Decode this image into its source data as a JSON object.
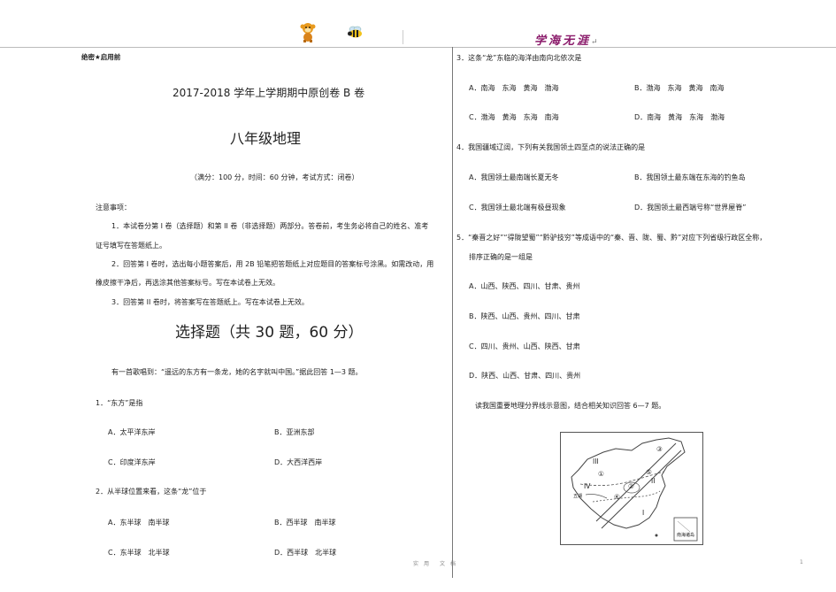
{
  "header": {
    "brand": "学海无涯",
    "brand_mark": "↵"
  },
  "left": {
    "secret_label": "绝密★启用前",
    "exam_title": "2017-2018 学年上学期期中原创卷 B 卷",
    "subject_title": "八年级地理",
    "exam_info": "（满分：100 分，时间：60 分钟，考试方式：闭卷）",
    "notes_heading": "注意事项：",
    "note1_a": "1．本试卷分第 I 卷（选择题）和第 II 卷（非选择题）两部分。答卷前，考生务必将自己的姓名、准考",
    "note1_b": "证号填写在答题纸上。",
    "note2_a": "2．回答第 I 卷时，选出每小题答案后，用 2B 铅笔把答题纸上对应题目的答案标号涂黑。如需改动，用",
    "note2_b": "橡皮擦干净后，再选涂其他答案标号。写在本试卷上无效。",
    "note3": "3．回答第 II 卷时，将答案写在答题纸上。写在本试卷上无效。",
    "section_title": "选择题（共 30 题，60 分）",
    "intro": "有一首歌唱到：“遥远的东方有一条龙，她的名字就叫中国。”据此回答 1—3 题。",
    "q1": "1．“东方”是指",
    "q1_a": "A．太平洋东岸",
    "q1_b": "B．亚洲东部",
    "q1_c": "C．印度洋东岸",
    "q1_d": "D．大西洋西岸",
    "q2": "2．从半球位置来看，这条“龙”位于",
    "q2_a": "A．东半球　南半球",
    "q2_b": "B．西半球　南半球",
    "q2_c": "C．东半球　北半球",
    "q2_d": "D．西半球　北半球"
  },
  "right": {
    "q3": "3．这条“龙”东临的海洋由南向北依次是",
    "q3_a": "A．南海　东海　黄海　渤海",
    "q3_b": "B．渤海　东海　黄海　南海",
    "q3_c": "C．渤海　黄海　东海　南海",
    "q3_d": "D．南海　黄海　东海　渤海",
    "q4": "4．我国疆域辽阔，下列有关我国领土四至点的说法正确的是",
    "q4_a": "A．我国领土最南端长夏无冬",
    "q4_b": "B．我国领土最东端在东海的钓鱼岛",
    "q4_c": "C．我国领土最北端有极昼现象",
    "q4_d": "D．我国领土最西端号称“世界屋脊”",
    "q5_a": "5．“秦晋之好”“得陇望蜀”“黔驴技穷”等成语中的“秦、晋、陇、蜀、黔”对应下列省级行政区全称，",
    "q5_b": "排序正确的是一组是",
    "q5_opt_a": "A．山西、陕西、四川、甘肃、贵州",
    "q5_opt_b": "B．陕西、山西、贵州、四川、甘肃",
    "q5_opt_c": "C．四川、贵州、山西、陕西、甘肃",
    "q5_opt_d": "D．陕西、山西、甘肃、四川、贵州",
    "map_intro": "读我国重要地理分界线示意图，结合相关知识回答 6—7 题。",
    "map_labels": [
      "III",
      "II",
      "IV",
      "I",
      "①",
      "②",
      "③",
      "④",
      "⑤"
    ],
    "map_small": "五湖",
    "inset_label": "南海诸岛"
  },
  "footer": {
    "center": "实　用　　文　档",
    "page": "1"
  }
}
